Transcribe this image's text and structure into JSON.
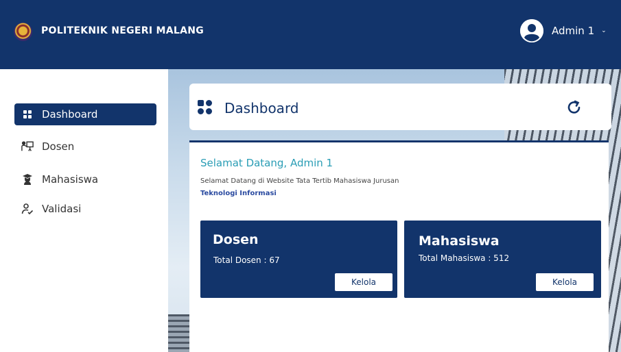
{
  "header": {
    "brand": "POLITEKNIK NEGERI MALANG",
    "user_name": "Admin 1",
    "caret": "⌄",
    "bg_color": "#12346b"
  },
  "sidebar": {
    "items": [
      {
        "label": "Dashboard",
        "icon": "grid-icon",
        "active": true
      },
      {
        "label": "Dosen",
        "icon": "presenter-icon",
        "active": false
      },
      {
        "label": "Mahasiswa",
        "icon": "graduate-icon",
        "active": false
      },
      {
        "label": "Validasi",
        "icon": "user-check-icon",
        "active": false
      }
    ]
  },
  "page": {
    "title": "Dashboard",
    "refresh_icon": "refresh-icon"
  },
  "welcome": {
    "heading": "Selamat Datang, Admin 1",
    "description": "Selamat Datang di Website Tata Tertib Mahasiswa Jurusan",
    "department": "Teknologi Informasi"
  },
  "cards": [
    {
      "title": "Dosen",
      "subtitle": "Total Dosen : 67",
      "button": "Kelola"
    },
    {
      "title": "Mahasiswa",
      "subtitle": "Total Mahasiswa : 512",
      "button": "Kelola"
    }
  ],
  "colors": {
    "primary": "#12346b",
    "accent": "#2a9db5",
    "link": "#2a4aa0"
  }
}
